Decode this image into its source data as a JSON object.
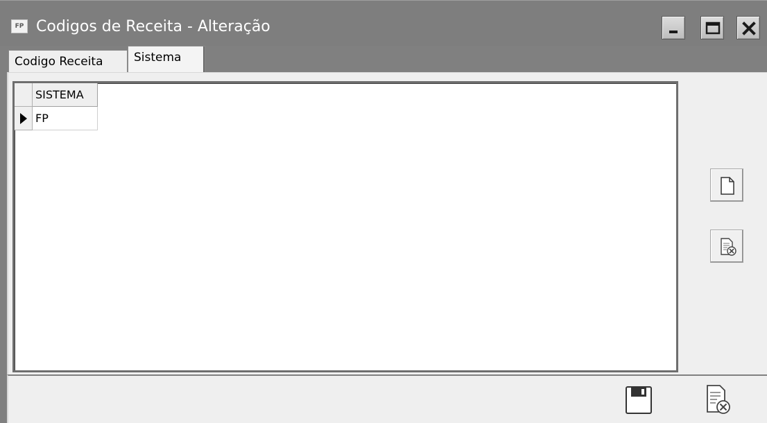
{
  "window": {
    "icon_label": "FP",
    "title": "Codigos de Receita - Alteração"
  },
  "tabs": [
    {
      "label": "Codigo Receita",
      "active": false
    },
    {
      "label": "Sistema",
      "active": true
    }
  ],
  "grid": {
    "columns": [
      "SISTEMA"
    ],
    "rows": [
      [
        "FP"
      ]
    ],
    "current_row": 0
  },
  "side_buttons": [
    {
      "icon": "new-document-icon"
    },
    {
      "icon": "delete-document-icon"
    }
  ],
  "bottom_buttons": [
    {
      "icon": "save-disk-icon"
    },
    {
      "icon": "cancel-document-icon"
    }
  ]
}
